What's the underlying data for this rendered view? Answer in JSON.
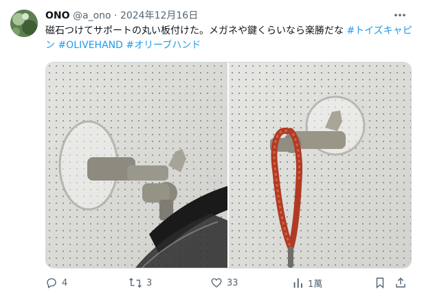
{
  "tweet": {
    "author_name": "ONO",
    "author_handle": "@a_ono",
    "separator": "·",
    "date": "2024年12月16日",
    "more_icon": "more-dots-icon",
    "body_text": "磁石つけてサポートの丸い板付けた。メガネや鍵くらいなら楽勝だな ",
    "hashtags": [
      "#トイズキャピン",
      "#OLIVEHAND",
      "#オリーブハンド"
    ],
    "link_color": "#1d9bf0"
  },
  "media": {
    "images": [
      {
        "name": "photo-left",
        "description": ""
      },
      {
        "name": "photo-right",
        "description": ""
      }
    ]
  },
  "actions": {
    "reply": {
      "icon": "reply-icon",
      "count": "4"
    },
    "retweet": {
      "icon": "retweet-icon",
      "count": "3"
    },
    "like": {
      "icon": "heart-icon",
      "count": "33"
    },
    "views": {
      "icon": "views-icon",
      "count": "1萬"
    },
    "bookmark": {
      "icon": "bookmark-icon"
    },
    "share": {
      "icon": "share-icon"
    }
  }
}
